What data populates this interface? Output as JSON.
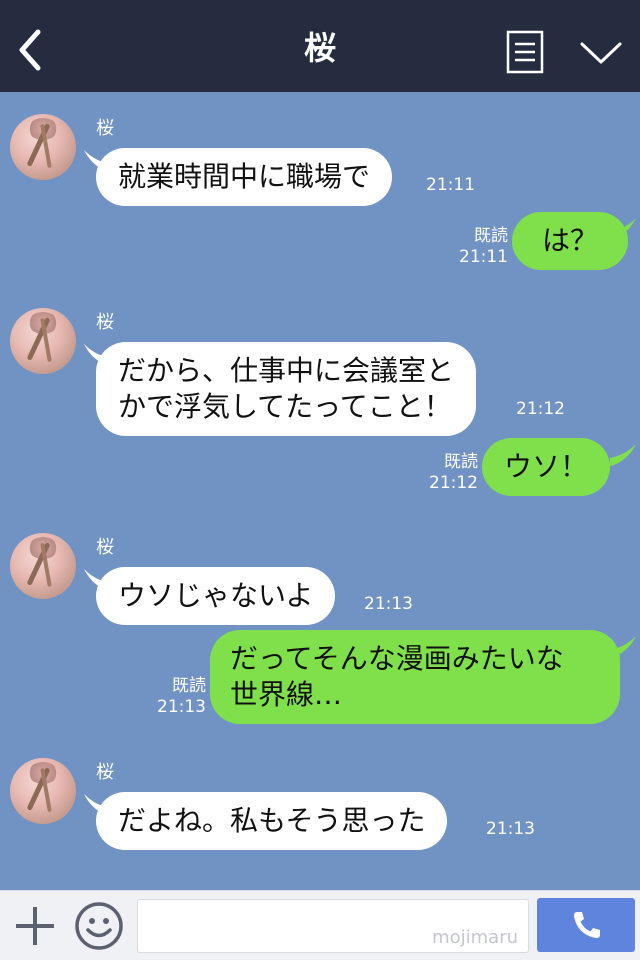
{
  "header": {
    "title": "桜"
  },
  "contact_name": "桜",
  "messages": [
    {
      "side": "left",
      "lines": [
        "就業時間中に職場で"
      ],
      "time": "21:11"
    },
    {
      "side": "right",
      "lines": [
        "は？"
      ],
      "read": "既読",
      "time": "21:11"
    },
    {
      "side": "left",
      "lines": [
        "だから、仕事中に会議室と",
        "かで浮気してたってこと！"
      ],
      "time": "21:12"
    },
    {
      "side": "right",
      "lines": [
        "ウソ！"
      ],
      "read": "既読",
      "time": "21:12"
    },
    {
      "side": "left",
      "lines": [
        "ウソじゃないよ"
      ],
      "time": "21:13"
    },
    {
      "side": "right",
      "lines": [
        "だってそんな漫画みたいな",
        "世界線…"
      ],
      "read": "既読",
      "time": "21:13"
    },
    {
      "side": "left",
      "lines": [
        "だよね。私もそう思った"
      ],
      "time": "21:13"
    }
  ],
  "footer": {
    "input_value": "",
    "watermark": "mojimaru"
  },
  "colors": {
    "header_bg": "#252c3f",
    "chat_bg": "#7193c4",
    "bubble_left": "#ffffff",
    "bubble_right": "#80e04b",
    "call_button": "#5e84de"
  },
  "icons": [
    "back-arrow-icon",
    "menu-list-icon",
    "chevron-down-icon",
    "plus-icon",
    "emoji-smile-icon",
    "phone-icon"
  ]
}
